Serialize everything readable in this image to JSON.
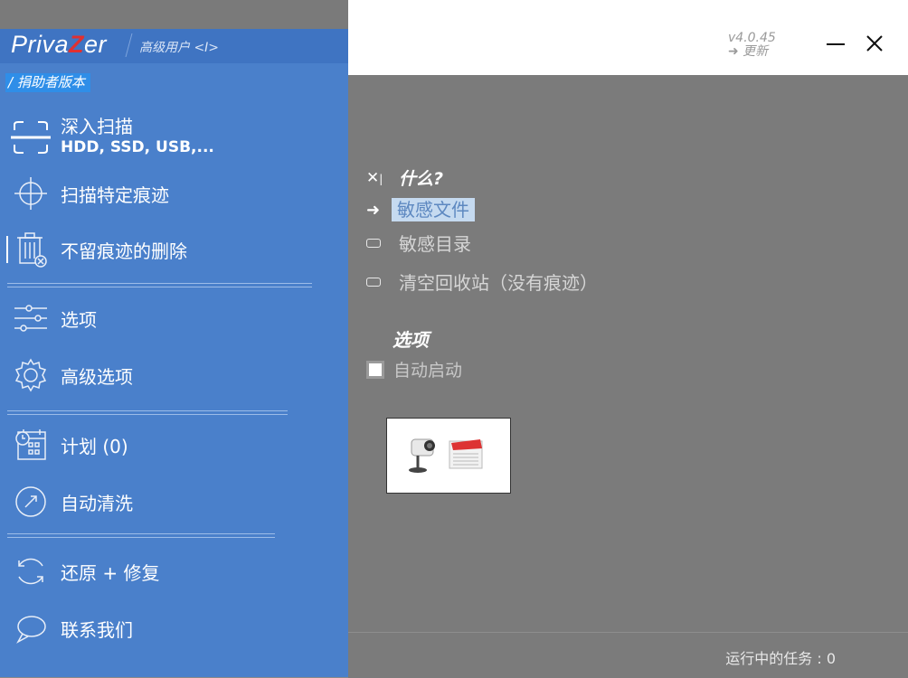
{
  "app": {
    "logo_prefix": "Priva",
    "logo_z": "Z",
    "logo_suffix": "er",
    "user_level": "高级用户 <I>",
    "donor_label": "/ 捐助者版本",
    "version": "v4.0.45",
    "update_label": "➜ 更新"
  },
  "sidebar": {
    "items": [
      {
        "label": "深入扫描",
        "sub": "HDD, SSD, USB,...",
        "icon": "scan-frame-icon"
      },
      {
        "label": "扫描特定痕迹",
        "icon": "crosshair-icon"
      },
      {
        "label": "不留痕迹的删除",
        "icon": "trash-delete-icon"
      },
      {
        "label": "选项",
        "icon": "sliders-icon"
      },
      {
        "label": "高级选项",
        "icon": "gear-icon"
      },
      {
        "label": "计划 (0)",
        "icon": "calendar-clock-icon"
      },
      {
        "label": "自动清洗",
        "icon": "gauge-icon"
      },
      {
        "label": "还原 + 修复",
        "icon": "restore-icon"
      },
      {
        "label": "联系我们",
        "icon": "chat-bubble-icon"
      }
    ]
  },
  "main": {
    "what_title": "什么?",
    "what_options": [
      {
        "label": "敏感文件",
        "selected": true
      },
      {
        "label": "敏感目录",
        "selected": false
      },
      {
        "label": "清空回收站（没有痕迹）",
        "selected": false
      }
    ],
    "options_title": "选项",
    "autostart_label": "自动启动",
    "autostart_checked": false
  },
  "status": {
    "running_tasks": "运行中的任务 : 0"
  },
  "colors": {
    "sidebar": "#4a80cb",
    "main_bg": "#7b7b7b",
    "accent_highlight": "#c5daf0",
    "logo_z": "#e03030"
  }
}
